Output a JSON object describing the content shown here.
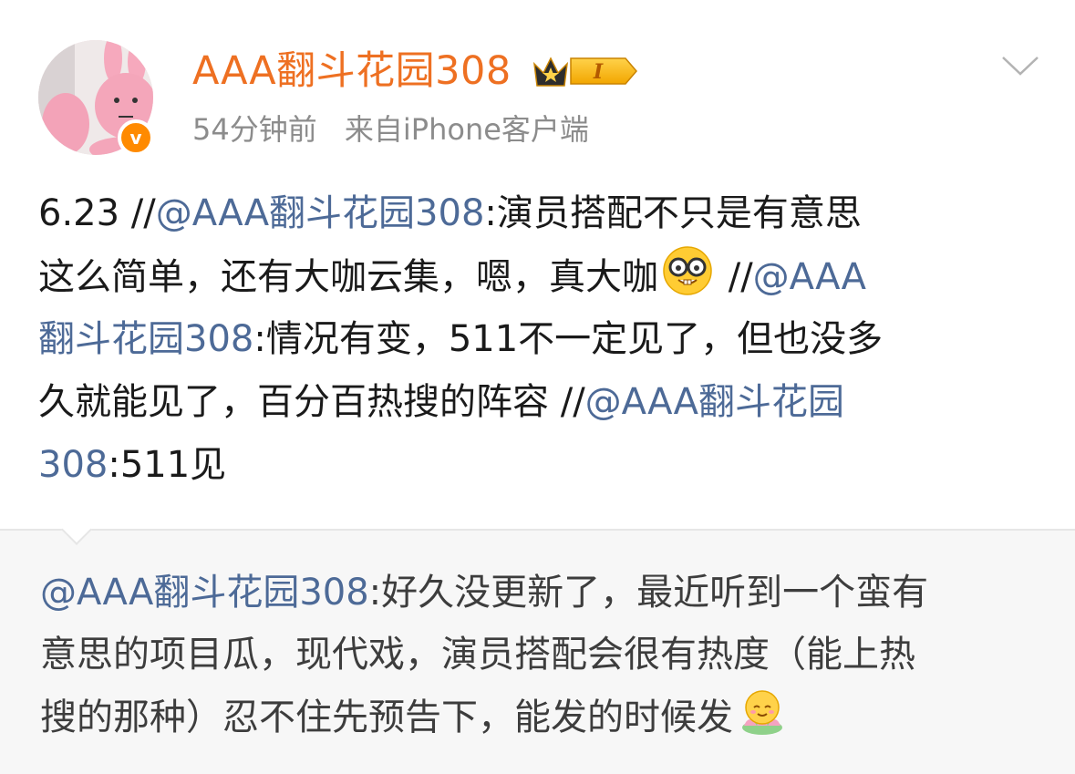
{
  "header": {
    "username": "AAA翻斗花园308",
    "vip_level": "I",
    "time": "54分钟前",
    "source": "来自iPhone客户端"
  },
  "post": {
    "lines": [
      [
        {
          "t": "6.23 //",
          "type": "text"
        },
        {
          "t": "@AAA翻斗花园308",
          "type": "mention"
        },
        {
          "t": ":演员搭配不只是有意思",
          "type": "text"
        }
      ],
      [
        {
          "t": "这么简单，还有大咖云集，嗯，真大咖",
          "type": "text"
        },
        {
          "t": "nerd-face-emoji",
          "type": "emoji"
        },
        {
          "t": " //",
          "type": "text"
        },
        {
          "t": "@AAA",
          "type": "mention"
        }
      ],
      [
        {
          "t": "翻斗花园308",
          "type": "mention"
        },
        {
          "t": ":情况有变，511不一定见了，但也没多",
          "type": "text"
        }
      ],
      [
        {
          "t": "久就能见了，百分百热搜的阵容 //",
          "type": "text"
        },
        {
          "t": "@AAA翻斗花园",
          "type": "mention"
        }
      ],
      [
        {
          "t": " 308",
          "type": "mention"
        },
        {
          "t": ":511见",
          "type": "text"
        }
      ]
    ]
  },
  "quoted": {
    "lines": [
      [
        {
          "t": "@AAA翻斗花园308",
          "type": "mention"
        },
        {
          "t": ":好久没更新了，最近听到一个蛮有",
          "type": "text"
        }
      ],
      [
        {
          "t": "意思的项目瓜，现代戏，演员搭配会很有热度（能上热",
          "type": "text"
        }
      ],
      [
        {
          "t": "搜的那种）忍不住先预告下，能发的时候发",
          "type": "text"
        },
        {
          "t": "blessed-lotus-emoji",
          "type": "emoji"
        }
      ]
    ]
  },
  "colors": {
    "username": "#ee7022",
    "mention": "#4d6a97",
    "meta": "#8c8c8c",
    "quoted_bg": "#f7f7f7"
  }
}
